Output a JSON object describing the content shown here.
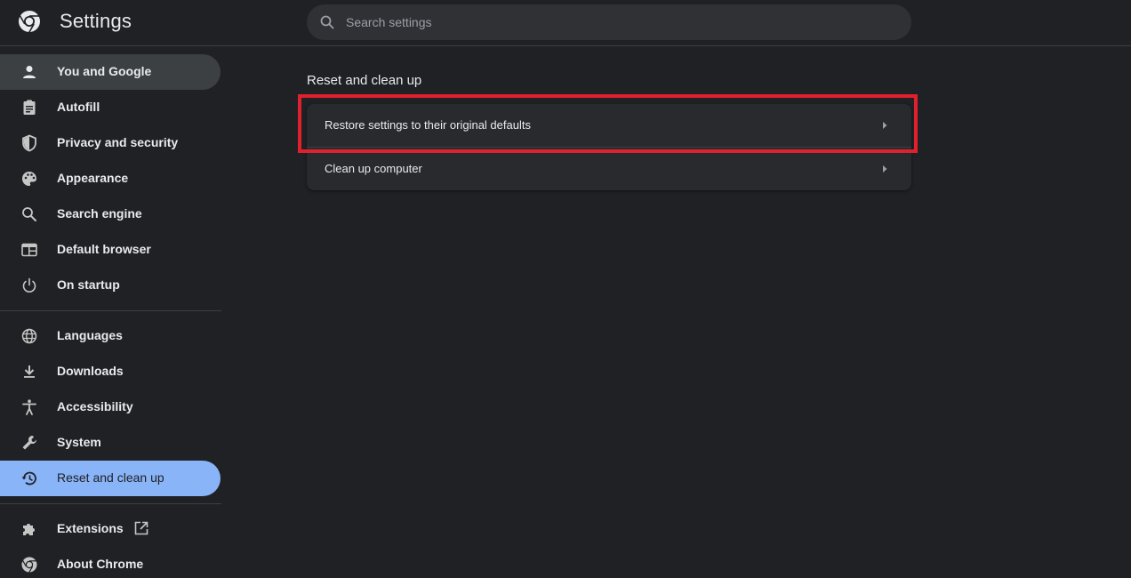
{
  "header": {
    "title": "Settings",
    "search_placeholder": "Search settings",
    "search_value": ""
  },
  "sidebar": {
    "items": [
      {
        "label": "You and Google",
        "icon": "person-icon"
      },
      {
        "label": "Autofill",
        "icon": "clipboard-icon"
      },
      {
        "label": "Privacy and security",
        "icon": "shield-icon"
      },
      {
        "label": "Appearance",
        "icon": "palette-icon"
      },
      {
        "label": "Search engine",
        "icon": "search-icon"
      },
      {
        "label": "Default browser",
        "icon": "browser-window-icon"
      },
      {
        "label": "On startup",
        "icon": "power-icon"
      },
      {
        "label": "Languages",
        "icon": "globe-icon"
      },
      {
        "label": "Downloads",
        "icon": "download-icon"
      },
      {
        "label": "Accessibility",
        "icon": "accessibility-icon"
      },
      {
        "label": "System",
        "icon": "wrench-icon"
      },
      {
        "label": "Reset and clean up",
        "icon": "history-icon",
        "active": true
      },
      {
        "label": "Extensions",
        "icon": "puzzle-icon"
      },
      {
        "label": "About Chrome",
        "icon": "chrome-icon"
      }
    ]
  },
  "main": {
    "section_title": "Reset and clean up",
    "rows": [
      {
        "label": "Restore settings to their original defaults"
      },
      {
        "label": "Clean up computer"
      }
    ]
  },
  "colors": {
    "background": "#202124",
    "accent": "#8ab4f8",
    "highlight": "#e0202e"
  }
}
